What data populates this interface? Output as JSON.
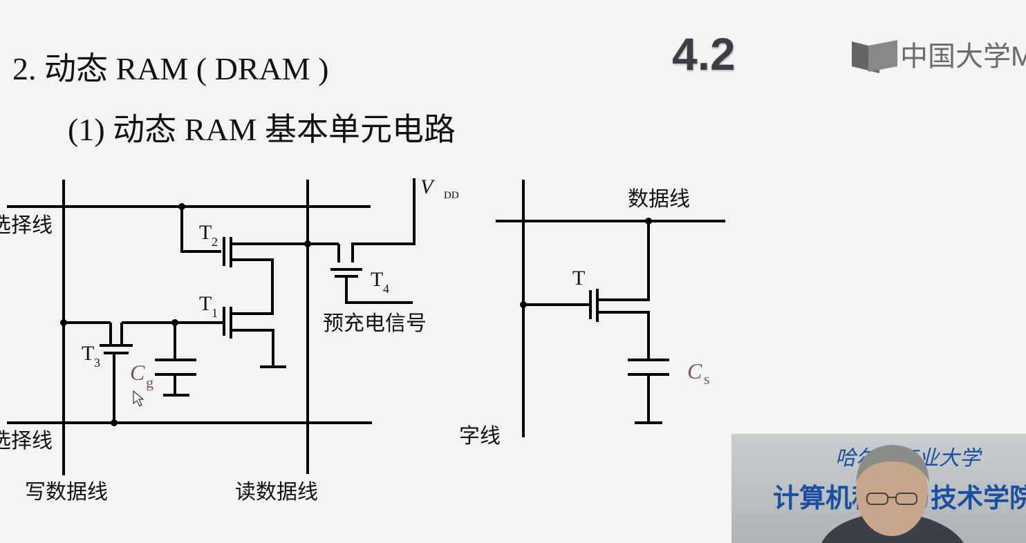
{
  "slide": {
    "title": "2. 动态 RAM ( DRAM )",
    "subtitle": "(1)  动态 RAM 基本单元电路",
    "section_number": "4.2"
  },
  "logo": {
    "text": "中国大学M"
  },
  "diagram_left": {
    "labels": {
      "row_select_top": "选择线",
      "row_select_bottom": "选择线",
      "write_data_line": "写数据线",
      "read_data_line": "读数据线",
      "precharge": "预充电信号",
      "vdd_main": "V",
      "vdd_sub": "DD",
      "t1": "T",
      "t1_sub": "1",
      "t2": "T",
      "t2_sub": "2",
      "t3": "T",
      "t3_sub": "3",
      "t4": "T",
      "t4_sub": "4",
      "cg": "C",
      "cg_sub": "g"
    }
  },
  "diagram_right": {
    "labels": {
      "data_line": "数据线",
      "word_line": "字线",
      "t": "T",
      "cs": "C",
      "cs_sub": "s"
    }
  },
  "video": {
    "university": "哈尔滨工业大学",
    "college": "计算机科学与技术学院"
  },
  "colors": {
    "capacitor_label": "#7a5560",
    "wire": "#000000"
  }
}
